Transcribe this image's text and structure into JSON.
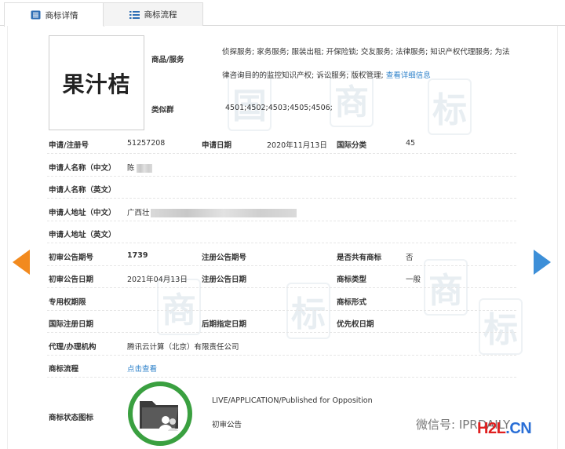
{
  "tabs": [
    {
      "label": "商标详情",
      "active": true,
      "icon": "document-list-icon"
    },
    {
      "label": "商标流程",
      "active": false,
      "icon": "grid-list-icon"
    }
  ],
  "mark": {
    "text": "果汁桔"
  },
  "goods": {
    "label": "商品/服务",
    "value": "侦探服务; 家务服务; 服装出租; 开保险锁; 交友服务; 法律服务; 知识产权代理服务; 为法律咨询目的的监控知识产权; 诉讼服务; 版权管理;",
    "more_link": "查看详细信息"
  },
  "similar_group": {
    "label": "类似群",
    "value": "4501;4502;4503;4505;4506;"
  },
  "fields": {
    "reg_no_label": "申请/注册号",
    "reg_no": "51257208",
    "app_date_label": "申请日期",
    "app_date": "2020年11月13日",
    "intl_class_label": "国际分类",
    "intl_class": "45",
    "name_cn_label": "申请人名称（中文）",
    "name_cn": "陈",
    "name_en_label": "申请人名称（英文）",
    "addr_cn_label": "申请人地址（中文）",
    "addr_cn": "广西壮",
    "addr_en_label": "申请人地址（英文）",
    "prelim_issue_label": "初审公告期号",
    "prelim_issue": "1739",
    "reg_issue_label": "注册公告期号",
    "shared_label": "是否共有商标",
    "shared": "否",
    "prelim_date_label": "初审公告日期",
    "prelim_date": "2021年04月13日",
    "reg_date_label": "注册公告日期",
    "type_label": "商标类型",
    "type": "一般",
    "exclusive_label": "专用权期限",
    "form_label": "商标形式",
    "intl_reg_date_label": "国际注册日期",
    "later_date_label": "后期指定日期",
    "priority_date_label": "优先权日期",
    "agent_label": "代理/办理机构",
    "agent": "腾讯云计算（北京）有限责任公司",
    "flow_label": "商标流程",
    "flow_link": "点击查看",
    "status_label": "商标状态图标",
    "status_en": "LIVE/APPLICATION/Published for Opposition",
    "status_cn": "初审公告"
  },
  "footer": {
    "wechat": "微信号: IPRDAILY",
    "brand_h": "H2L",
    "brand_dot": ".CN"
  },
  "colors": {
    "accent": "#2a7fc9",
    "prev_arrow": "#f28a1e",
    "next_arrow": "#3d8fd8",
    "status_ring": "#3aa040"
  }
}
